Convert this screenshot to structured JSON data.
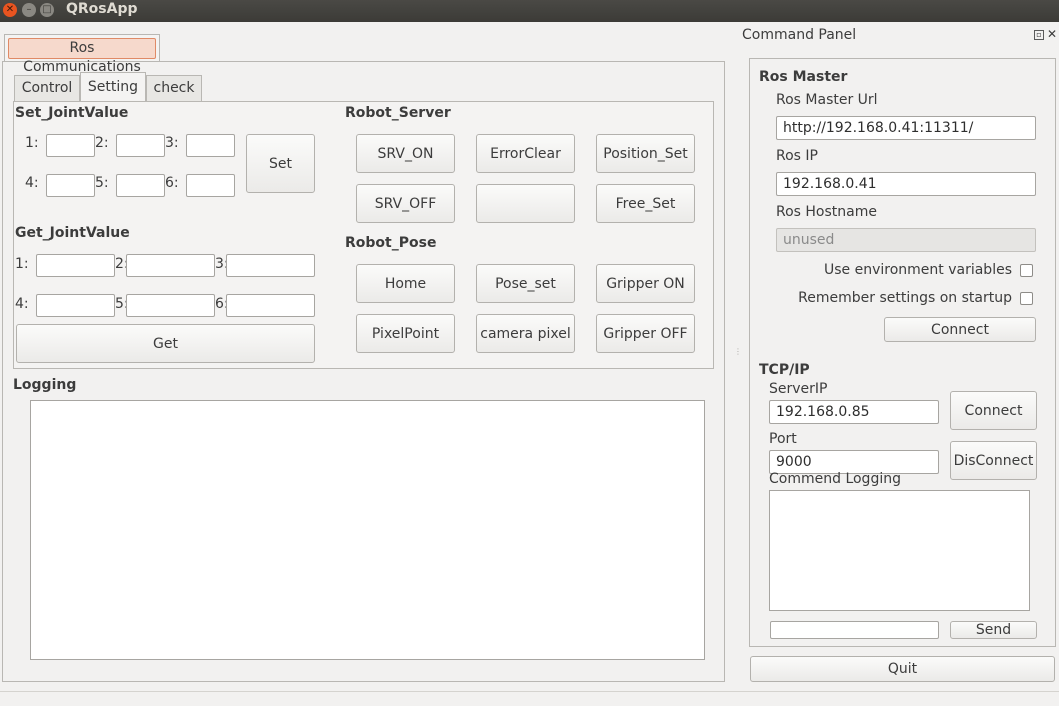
{
  "window": {
    "title": "QRosApp"
  },
  "main": {
    "group_tab": "Ros Communications",
    "tabs": [
      "Control",
      "Setting",
      "check"
    ],
    "set_joint": {
      "title": "Set_JointValue",
      "labels": [
        "1:",
        "2:",
        "3:",
        "4:",
        "5:",
        "6:"
      ],
      "button": "Set"
    },
    "get_joint": {
      "title": "Get_JointValue",
      "labels": [
        "1:",
        "2:",
        "3:",
        "4:",
        "5:",
        "6:"
      ],
      "button": "Get"
    },
    "robot_server": {
      "title": "Robot_Server",
      "buttons": [
        "SRV_ON",
        "ErrorClear",
        "Position_Set",
        "SRV_OFF",
        "",
        "Free_Set"
      ]
    },
    "robot_pose": {
      "title": "Robot_Pose",
      "buttons": [
        "Home",
        "Pose_set",
        "Gripper ON",
        "PixelPoint",
        "camera pixel",
        "Gripper OFF"
      ]
    },
    "logging": {
      "title": "Logging"
    }
  },
  "dock": {
    "title": "Command Panel",
    "ros_master": {
      "title": "Ros Master",
      "url_label": "Ros Master Url",
      "url_value": "http://192.168.0.41:11311/",
      "ip_label": "Ros IP",
      "ip_value": "192.168.0.41",
      "hostname_label": "Ros Hostname",
      "hostname_value": "unused",
      "env_label": "Use environment variables",
      "env_checked": false,
      "remember_label": "Remember settings on startup",
      "remember_checked": false,
      "connect": "Connect"
    },
    "tcp": {
      "title": "TCP/IP",
      "server_label": "ServerIP",
      "server_value": "192.168.0.85",
      "connect": "Connect",
      "port_label": "Port",
      "port_value": "9000",
      "disconnect": "DisConnect",
      "log_label": "Commend Logging",
      "send": "Send",
      "send_value": ""
    },
    "quit": "Quit"
  }
}
